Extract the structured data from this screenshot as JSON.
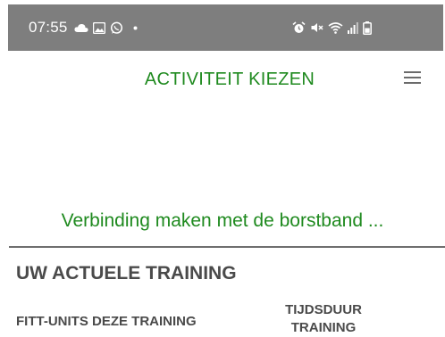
{
  "status_bar": {
    "time": "07:55",
    "left_icons": [
      "cloud-icon",
      "image-icon",
      "whatsapp-icon",
      "dot-icon"
    ],
    "right_icons": [
      "alarm-icon",
      "mute-icon",
      "wifi-icon",
      "signal-icon",
      "battery-icon"
    ],
    "background": "#7e7e7e"
  },
  "app_bar": {
    "title": "ACTIVITEIT KIEZEN",
    "menu_icon": "hamburger-menu-icon",
    "accent_color": "#1f8a1f"
  },
  "connection": {
    "message": "Verbinding maken met de borstband ..."
  },
  "training": {
    "section_title": "UW ACTUELE TRAINING",
    "fitt_units_label": "FITT-UNITS DEZE TRAINING",
    "duration_label_line1": "TIJDSDUUR",
    "duration_label_line2": "TRAINING"
  }
}
